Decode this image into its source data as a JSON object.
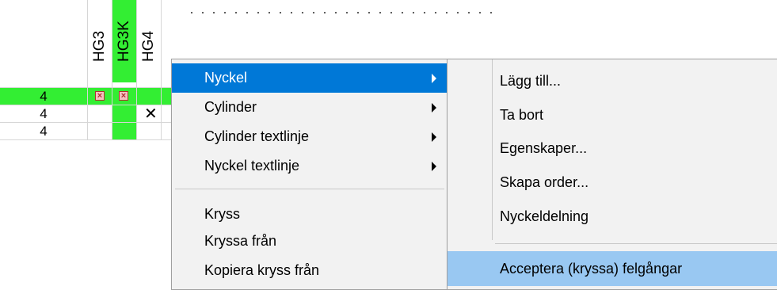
{
  "grid": {
    "headers": [
      "HG3",
      "HG3K",
      "HG4"
    ],
    "rows": [
      {
        "value": "4"
      },
      {
        "value": "4"
      },
      {
        "value": "4"
      }
    ],
    "cross_mark": "×",
    "big_x": "✕"
  },
  "context_menu": {
    "items": [
      {
        "label": "Nyckel",
        "submenu": true
      },
      {
        "label": "Cylinder",
        "submenu": true
      },
      {
        "label": "Cylinder textlinje",
        "submenu": true
      },
      {
        "label": "Nyckel textlinje",
        "submenu": true
      },
      {
        "label": "Kryss",
        "submenu": false
      },
      {
        "label": "Kryssa från",
        "submenu": false
      },
      {
        "label": "Kopiera kryss från",
        "submenu": false
      }
    ]
  },
  "submenu": {
    "items": [
      {
        "label": "Lägg till..."
      },
      {
        "label": "Ta bort"
      },
      {
        "label": "Egenskaper..."
      },
      {
        "label": "Skapa order..."
      },
      {
        "label": "Nyckeldelning"
      },
      {
        "label": "Acceptera (kryssa) felgångar"
      }
    ]
  },
  "colors": {
    "row_highlight": "#33ee33",
    "menu_highlight": "#0078d7",
    "submenu_highlight": "#99c8f2"
  }
}
